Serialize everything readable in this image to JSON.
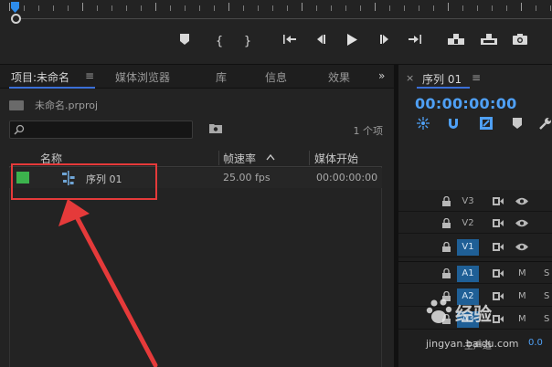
{
  "project_panel": {
    "tabs": [
      {
        "label": "项目:未命名",
        "active": true
      },
      {
        "label": "媒体浏览器",
        "active": false
      },
      {
        "label": "库",
        "active": false
      },
      {
        "label": "信息",
        "active": false
      },
      {
        "label": "效果",
        "active": false
      }
    ],
    "menu_glyph": "≡",
    "more_glyph": "»",
    "project_file": "未命名.prproj",
    "search": {
      "value": "",
      "placeholder": ""
    },
    "item_count": "1 个项",
    "columns": {
      "name": "名称",
      "fps": "帧速率",
      "start": "媒体开始"
    },
    "rows": [
      {
        "swatch_color": "#3cb34d",
        "name": "序列 01",
        "fps": "25.00 fps",
        "start": "00:00:00:00"
      }
    ]
  },
  "timeline_panel": {
    "close_glyph": "×",
    "title": "序列 01",
    "menu_glyph": "≡",
    "timecode": "00:00:00:00",
    "tracks": [
      {
        "label": "V3",
        "active": false,
        "kind": "video"
      },
      {
        "label": "V2",
        "active": false,
        "kind": "video"
      },
      {
        "label": "V1",
        "active": true,
        "kind": "video"
      },
      {
        "label": "A1",
        "active": true,
        "kind": "audio",
        "m": "M",
        "s": "S"
      },
      {
        "label": "A2",
        "active": true,
        "kind": "audio",
        "m": "M",
        "s": "S"
      },
      {
        "label": "A3",
        "active": true,
        "kind": "audio",
        "m": "M",
        "s": "S"
      }
    ],
    "master_label": "主声道",
    "master_value": "0.0"
  },
  "watermark": {
    "brand": "经验",
    "url": "jingyan.baidu.com"
  },
  "colors": {
    "accent": "#3a6fd8",
    "timecode": "#4fa0f5",
    "highlight": "#e53a3a",
    "track_on": "#1f5f96"
  }
}
